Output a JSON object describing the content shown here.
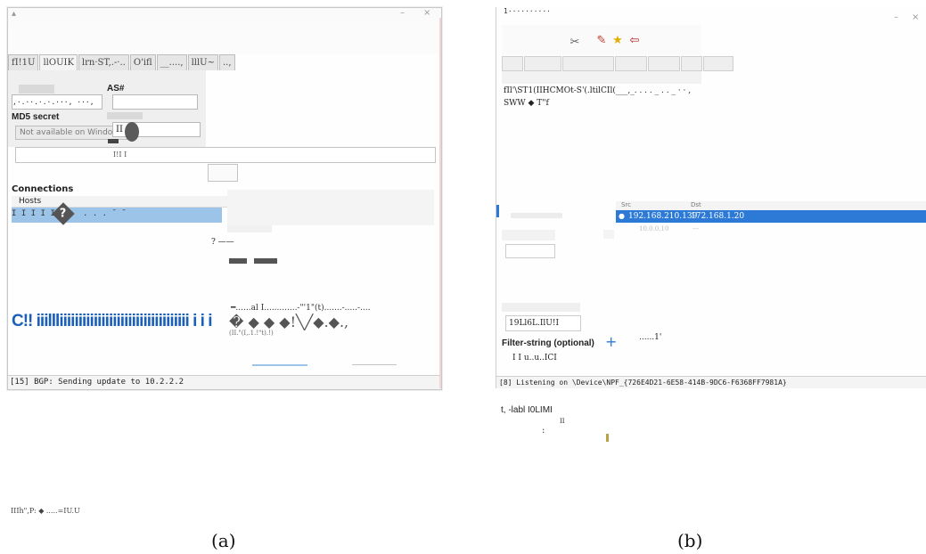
{
  "panel_a": {
    "tabs": [
      "fI!1U",
      "llOUIK",
      "lrn·ST,.-·..",
      "O'ifl",
      "__....,",
      "lllU~",
      "..,"
    ],
    "as_label": "AS#",
    "md5_label": "MD5 secret",
    "dotted_value": ",·.··.·.·.···, ···,",
    "unavailable_button": "Not available on Windows",
    "secret_field_value": "II",
    "small_text": "I!I I",
    "connections_label": "Connections",
    "hosts_header": "Hosts",
    "row_text_left": "I I I I I",
    "row_text_right": ". . . ˉ ˉ",
    "question_glyph": "?",
    "small_mark": "? ——",
    "blue_text": "C!! iiillliiiiiiiiiiiiiiiiiiiiiiiiiiiiiiiiii i i i",
    "garbled_line": "━......al I.............-\"'1\"(t).......-.....-....",
    "glyph_row": "� ◆ ◆ ◆!╲╱◆.◆.,",
    "garbled_sub": "(II.\"(I,.1.!\"t).!)",
    "status": "[15] BGP: Sending update to 10.2.2.2"
  },
  "panel_b": {
    "title_text": "1··········",
    "garbled_line1": "fIl'\\ST1(IIHCMOt-S'(.ltilCIl(___,_.  . . . _ . . _ · · ,",
    "garbled_line2": "SWW  ◆  T\"f",
    "col_src": "Src",
    "col_dst": "Dst",
    "row_src": "192.168.210.139",
    "row_dst": "172.168.1.20",
    "row2_src": "10.0.0.10",
    "row2_dst": "---",
    "field_text": "19Ll6L.IlU!I",
    "filter_label": "Filter-string (optional)",
    "filter_value": "I I u..u..ICI",
    "plus_label": "+",
    "dots_text": "......1'",
    "status": "[8] Listening on \\Device\\NPF_{726E4D21-6E58-414B-9DC6-F6368FF7981A}",
    "below_line": "t, -labl  I0LIMI",
    "below_sub": "II",
    "below_colon": ":"
  },
  "bottom_left_text": "IIIh\",P:  ◆  .....=IU.U",
  "captions": {
    "a": "(a)",
    "b": "(b)"
  }
}
